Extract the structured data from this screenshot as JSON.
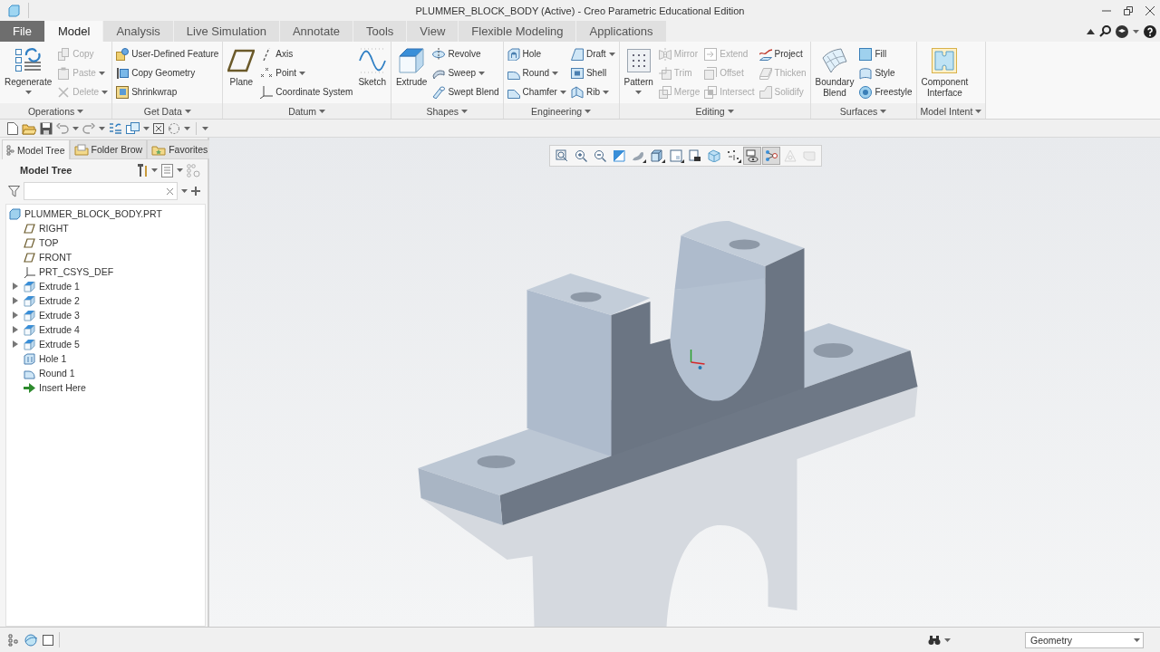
{
  "window": {
    "title": "PLUMMER_BLOCK_BODY (Active) - Creo Parametric Educational Edition"
  },
  "tabs": [
    {
      "label": "File",
      "kind": "file",
      "selected": false
    },
    {
      "label": "Model",
      "kind": "tab",
      "selected": true
    },
    {
      "label": "Analysis",
      "kind": "tab",
      "selected": false
    },
    {
      "label": "Live Simulation",
      "kind": "tab",
      "selected": false
    },
    {
      "label": "Annotate",
      "kind": "tab",
      "selected": false
    },
    {
      "label": "Tools",
      "kind": "tab",
      "selected": false
    },
    {
      "label": "View",
      "kind": "tab",
      "selected": false
    },
    {
      "label": "Flexible Modeling",
      "kind": "tab",
      "selected": false
    },
    {
      "label": "Applications",
      "kind": "tab",
      "selected": false
    }
  ],
  "ribbon": {
    "groups": [
      {
        "label": "Operations",
        "items": [
          {
            "kind": "large",
            "label": "Regenerate",
            "disabled": false,
            "menu": true
          },
          {
            "kind": "column",
            "items": [
              {
                "label": "Copy",
                "disabled": true,
                "menu": false
              },
              {
                "label": "Paste",
                "disabled": true,
                "menu": true
              },
              {
                "label": "Delete",
                "disabled": true,
                "menu": true
              }
            ]
          }
        ]
      },
      {
        "label": "Get Data",
        "items": [
          {
            "kind": "column",
            "items": [
              {
                "label": "User-Defined Feature",
                "disabled": false,
                "menu": false
              },
              {
                "label": "Copy Geometry",
                "disabled": false,
                "menu": false
              },
              {
                "label": "Shrinkwrap",
                "disabled": false,
                "menu": false
              }
            ]
          }
        ]
      },
      {
        "label": "Datum",
        "items": [
          {
            "kind": "large",
            "label": "Plane",
            "disabled": false,
            "menu": false
          },
          {
            "kind": "column",
            "items": [
              {
                "label": "Axis",
                "disabled": false,
                "menu": false
              },
              {
                "label": "Point",
                "disabled": false,
                "menu": true
              },
              {
                "label": "Coordinate System",
                "disabled": false,
                "menu": false
              }
            ]
          },
          {
            "kind": "large",
            "label": "Sketch",
            "disabled": false,
            "menu": false
          }
        ]
      },
      {
        "label": "Shapes",
        "items": [
          {
            "kind": "large",
            "label": "Extrude",
            "disabled": false,
            "menu": false
          },
          {
            "kind": "column",
            "items": [
              {
                "label": "Revolve",
                "disabled": false,
                "menu": false
              },
              {
                "label": "Sweep",
                "disabled": false,
                "menu": true
              },
              {
                "label": "Swept Blend",
                "disabled": false,
                "menu": false
              }
            ]
          }
        ]
      },
      {
        "label": "Engineering",
        "items": [
          {
            "kind": "column",
            "items": [
              {
                "label": "Hole",
                "disabled": false,
                "menu": false
              },
              {
                "label": "Round",
                "disabled": false,
                "menu": true
              },
              {
                "label": "Chamfer",
                "disabled": false,
                "menu": true
              }
            ]
          },
          {
            "kind": "column",
            "items": [
              {
                "label": "Draft",
                "disabled": false,
                "menu": true
              },
              {
                "label": "Shell",
                "disabled": false,
                "menu": false
              },
              {
                "label": "Rib",
                "disabled": false,
                "menu": true
              }
            ]
          }
        ]
      },
      {
        "label": "Editing",
        "items": [
          {
            "kind": "large",
            "label": "Pattern",
            "disabled": false,
            "menu": true
          },
          {
            "kind": "column",
            "items": [
              {
                "label": "Mirror",
                "disabled": true,
                "menu": false
              },
              {
                "label": "Trim",
                "disabled": true,
                "menu": false
              },
              {
                "label": "Merge",
                "disabled": true,
                "menu": false
              }
            ]
          },
          {
            "kind": "column",
            "items": [
              {
                "label": "Extend",
                "disabled": true,
                "menu": false
              },
              {
                "label": "Offset",
                "disabled": true,
                "menu": false
              },
              {
                "label": "Intersect",
                "disabled": true,
                "menu": false
              }
            ]
          },
          {
            "kind": "column",
            "items": [
              {
                "label": "Project",
                "disabled": false,
                "menu": false
              },
              {
                "label": "Thicken",
                "disabled": true,
                "menu": false
              },
              {
                "label": "Solidify",
                "disabled": true,
                "menu": false
              }
            ]
          }
        ]
      },
      {
        "label": "Surfaces",
        "items": [
          {
            "kind": "large",
            "label": "Boundary Blend",
            "disabled": false,
            "menu": false
          },
          {
            "kind": "column",
            "items": [
              {
                "label": "Fill",
                "disabled": false,
                "menu": false
              },
              {
                "label": "Style",
                "disabled": false,
                "menu": false
              },
              {
                "label": "Freestyle",
                "disabled": false,
                "menu": false
              }
            ]
          }
        ]
      },
      {
        "label": "Model Intent",
        "items": [
          {
            "kind": "large",
            "label": "Component Interface",
            "disabled": false,
            "menu": false
          }
        ]
      }
    ]
  },
  "navigator": {
    "tabs": [
      {
        "label": "Model Tree",
        "kind": "tree",
        "selected": true
      },
      {
        "label": "Folder Brow",
        "kind": "folder",
        "selected": false
      },
      {
        "label": "Favorites",
        "kind": "favorites",
        "selected": false
      }
    ],
    "title": "Model Tree",
    "tree": {
      "label": "PLUMMER_BLOCK_BODY.PRT",
      "kind": "part",
      "children": [
        {
          "label": "RIGHT",
          "kind": "datum_plane"
        },
        {
          "label": "TOP",
          "kind": "datum_plane"
        },
        {
          "label": "FRONT",
          "kind": "datum_plane"
        },
        {
          "label": "PRT_CSYS_DEF",
          "kind": "csys"
        },
        {
          "label": "Extrude 1",
          "kind": "extrude",
          "expanded": false
        },
        {
          "label": "Extrude 2",
          "kind": "extrude",
          "expanded": false
        },
        {
          "label": "Extrude 3",
          "kind": "extrude",
          "expanded": false
        },
        {
          "label": "Extrude 4",
          "kind": "extrude",
          "expanded": false
        },
        {
          "label": "Extrude 5",
          "kind": "extrude",
          "expanded": false
        },
        {
          "label": "Hole 1",
          "kind": "hole"
        },
        {
          "label": "Round 1",
          "kind": "round"
        },
        {
          "label": "Insert Here",
          "kind": "insert"
        }
      ]
    }
  },
  "view_toolbar": {
    "buttons": [
      {
        "on": false,
        "disabled": false,
        "menu": false
      },
      {
        "on": false,
        "disabled": false,
        "menu": false
      },
      {
        "on": false,
        "disabled": false,
        "menu": false
      },
      {
        "on": false,
        "disabled": false,
        "menu": false
      },
      {
        "on": false,
        "disabled": false,
        "menu": true
      },
      {
        "on": false,
        "disabled": false,
        "menu": true
      },
      {
        "on": false,
        "disabled": false,
        "menu": true
      },
      {
        "on": false,
        "disabled": false,
        "menu": false
      },
      {
        "on": false,
        "disabled": false,
        "menu": false
      },
      {
        "on": false,
        "disabled": false,
        "menu": true
      },
      {
        "on": true,
        "disabled": false,
        "menu": false
      },
      {
        "on": true,
        "disabled": false,
        "menu": false
      },
      {
        "on": false,
        "disabled": true,
        "menu": false
      },
      {
        "on": false,
        "disabled": true,
        "menu": false
      }
    ]
  },
  "status_bar": {
    "selection_filter": "Geometry"
  }
}
